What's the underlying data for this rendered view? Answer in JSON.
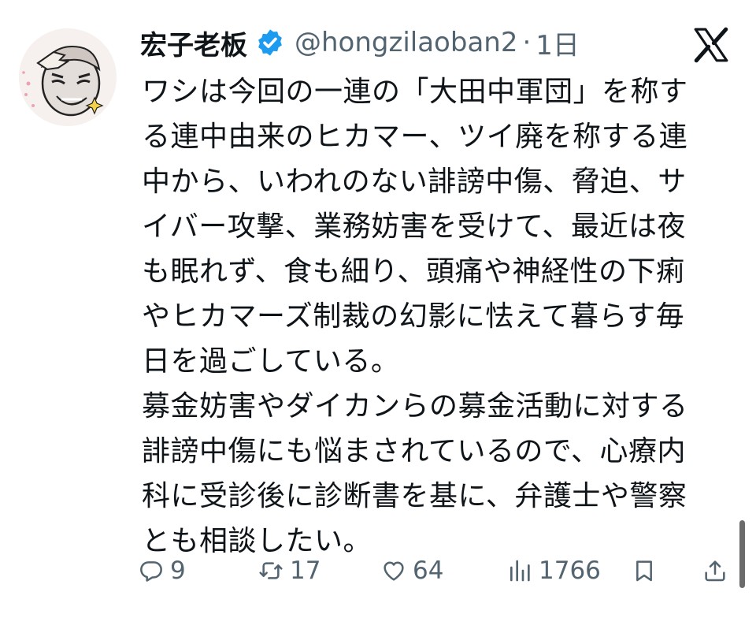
{
  "tweet": {
    "author": {
      "display_name": "宏子老板",
      "verified": true,
      "handle": "@hongzilaoban2",
      "separator": "·",
      "time": "1日"
    },
    "platform_icon": "x-logo-icon",
    "text_lines": [
      "ワシは今回の一連の「大田中軍団」を称す",
      "る連中由来のヒカマー、ツイ廃を称する連",
      "中から、いわれのない誹謗中傷、脅迫、サ",
      "イバー攻撃、業務妨害を受けて、最近は夜",
      "も眠れず、食も細り、頭痛や神経性の下痢",
      "やヒカマーズ制裁の幻影に怯えて暮らす毎",
      "日を過ごしている。",
      "募金妨害やダイカンらの募金活動に対する",
      "誹謗中傷にも悩まされているので、心療内",
      "科に受診後に診断書を基に、弁護士や警察",
      "とも相談したい。"
    ],
    "actions": {
      "reply": {
        "icon": "reply-icon",
        "count": "9"
      },
      "repost": {
        "icon": "repost-icon",
        "count": "17"
      },
      "like": {
        "icon": "heart-icon",
        "count": "64"
      },
      "views": {
        "icon": "views-icon",
        "count": "1766"
      },
      "bookmark": {
        "icon": "bookmark-icon"
      },
      "share": {
        "icon": "share-icon"
      }
    }
  },
  "colors": {
    "text_primary": "#0f1419",
    "text_secondary": "#536471",
    "verified_blue": "#1d9bf0",
    "background": "#ffffff"
  }
}
